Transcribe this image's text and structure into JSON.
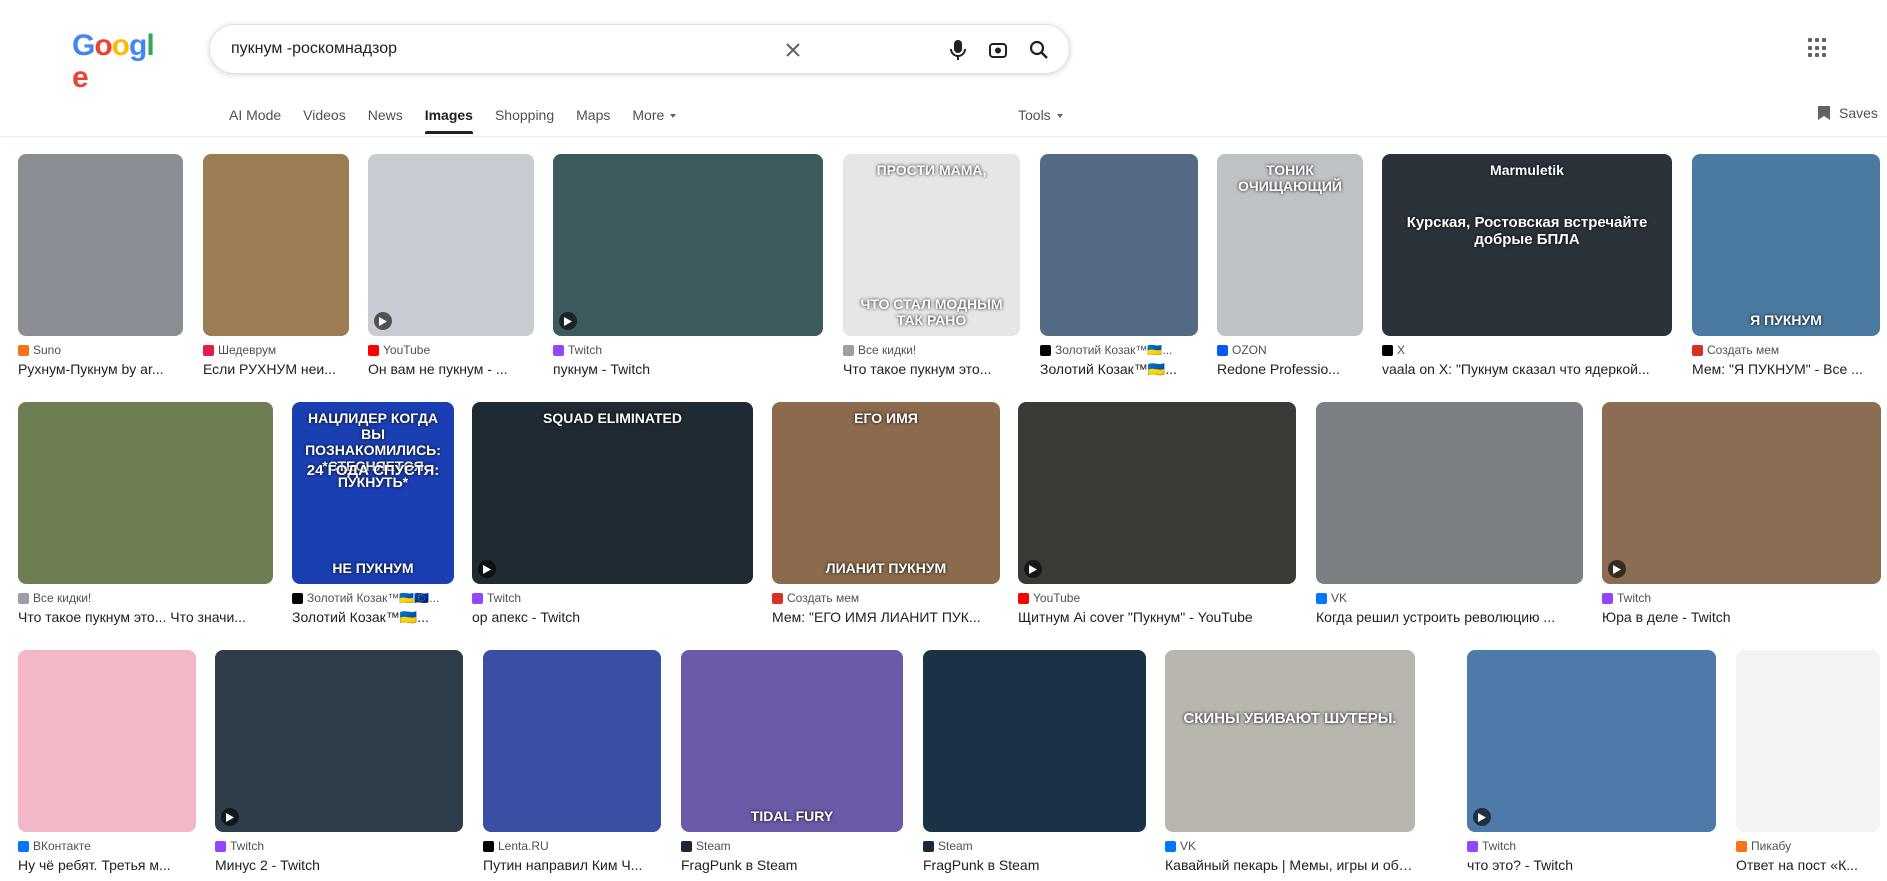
{
  "search": {
    "query": "пукнум -роскомнадзор"
  },
  "tabs": [
    "AI Mode",
    "Videos",
    "News",
    "Images",
    "Shopping",
    "Maps",
    "More"
  ],
  "active_tab": "Images",
  "tools_label": "Tools",
  "saves_label": "Saves",
  "logo": [
    "G",
    "o",
    "o",
    "g",
    "l",
    "e"
  ],
  "colors": {
    "blue": "#4285f4",
    "red": "#ea4335",
    "yellow": "#fbbc05",
    "green": "#34a853"
  },
  "rows": [
    [
      {
        "source": "Suno",
        "title": "Рухнум-Пукнум by ar...",
        "fav": "#f97316",
        "bg": "#8a8d93"
      },
      {
        "source": "Шедеврум",
        "title": "Если РУХНУМ неи...",
        "fav": "#e11d48",
        "bg": "#9c7c52"
      },
      {
        "source": "YouTube",
        "title": "Он вам не пукнум - ...",
        "fav": "#ff0000",
        "bg": "#c9cdd3"
      },
      {
        "source": "Twitch",
        "title": "пукнум - Twitch",
        "fav": "#9146ff",
        "bg": "#3d5a5e"
      },
      {
        "source": "Все кидки!",
        "title": "Что такое пукнум это...",
        "fav": "#9aa0a6",
        "bg": "#e6e6e6",
        "overlay_top": "ПРОСТИ МАМА,",
        "overlay_bottom": "ЧТО СТАЛ МОДНЫМ ТАК РАНО"
      },
      {
        "source": "Золотий Козак™🇺🇦...",
        "title": "Золотий Козак™🇺🇦...",
        "fav": "#000000",
        "bg": "#556a85"
      },
      {
        "source": "OZON",
        "title": "Redone Professio...",
        "fav": "#005bff",
        "bg": "#bfc2c5",
        "overlay_top": "ТОНИК ОЧИЩАЮЩИЙ"
      },
      {
        "source": "X",
        "title": "vaala on X: \"Пукнум сказал что ядеркой...",
        "fav": "#000000",
        "bg": "#2b323a",
        "overlay_top": "Marmuletik",
        "overlay_mid": "Курская, Ростовская встречайте добрые БПЛА"
      },
      {
        "source": "Создать мем",
        "title": "Мем: \"Я ПУКНУМ\" - Все ...",
        "fav": "#d93025",
        "bg": "#4a7aa0",
        "overlay_bottom": "Я ПУКНУМ"
      }
    ],
    [
      {
        "source": "Все кидки!",
        "title": "Что такое пукнум это... Что значи...",
        "fav": "#9aa0a6",
        "bg": "#6f7d52"
      },
      {
        "source": "Золотий Козак™🇺🇦🇪🇺...",
        "title": "Золотий Козак™🇺🇦...",
        "fav": "#000000",
        "bg": "#1a3fb2",
        "overlay_top": "НАЦЛИДЕР КОГДА ВЫ ПОЗНАКОМИЛИСЬ: *СТЕСНЯЕТСЯ ПУКНУТЬ*",
        "overlay_mid": "24 ГОДА СПУСТЯ:",
        "overlay_bottom": "НЕ ПУКНУМ"
      },
      {
        "source": "Twitch",
        "title": "ор апекс - Twitch",
        "fav": "#9146ff",
        "bg": "#1f2a33",
        "overlay_top": "SQUAD ELIMINATED"
      },
      {
        "source": "Создать мем",
        "title": "Мем: \"ЕГО ИМЯ ЛИАНИТ ПУК...",
        "fav": "#d93025",
        "bg": "#8c6a4d",
        "overlay_top": "ЕГО ИМЯ",
        "overlay_bottom": "ЛИАНИТ ПУКНУМ"
      },
      {
        "source": "YouTube",
        "title": "Щитнум Ai cover \"Пукнум\" - YouTube",
        "fav": "#ff0000",
        "bg": "#3b3a36"
      },
      {
        "source": "VK",
        "title": "Когда решил устроить революцию ...",
        "fav": "#0077ff",
        "bg": "#7c7f84"
      },
      {
        "source": "Twitch",
        "title": "Юра в деле - Twitch",
        "fav": "#9146ff",
        "bg": "#8a6d52"
      }
    ],
    [
      {
        "source": "ВКонтакте",
        "title": "Ну чё ребят. Третья м...",
        "fav": "#0077ff",
        "bg": "#f2b8c8"
      },
      {
        "source": "Twitch",
        "title": "Минус 2 - Twitch",
        "fav": "#9146ff",
        "bg": "#2f3d4a"
      },
      {
        "source": "Lenta.RU",
        "title": "Путин направил Ким Ч...",
        "fav": "#000000",
        "bg": "#3a4fa3"
      },
      {
        "source": "Steam",
        "title": "FragPunk в Steam",
        "fav": "#1b2838",
        "bg": "#6a5aa8",
        "overlay_bottom": "TIDAL FURY"
      },
      {
        "source": "Steam",
        "title": "FragPunk в Steam",
        "fav": "#1b2838",
        "bg": "#1a3344"
      },
      {
        "source": "VK",
        "title": "Кавайный пекарь | Мемы, игры и обсу...",
        "fav": "#0077ff",
        "bg": "#b9b6b0",
        "overlay_mid": "СКИНЫ УБИВАЮТ ШУТЕРЫ."
      },
      {
        "source": "Twitch",
        "title": "что это? - Twitch",
        "fav": "#9146ff",
        "bg": "#4d7aa8"
      },
      {
        "source": "Пикабу",
        "title": "Ответ на пост «К...",
        "fav": "#f97316",
        "bg": "#f4f4f4"
      }
    ]
  ]
}
